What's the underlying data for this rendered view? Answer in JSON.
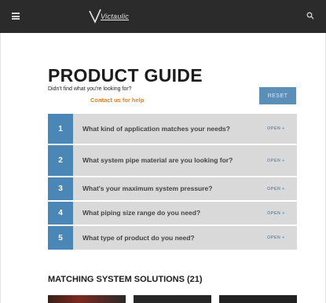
{
  "header": {
    "logo_text": "Victaulic",
    "menu_icon": "hamburger-menu-icon",
    "search_icon": "search-icon"
  },
  "guide": {
    "title": "PRODUCT GUIDE",
    "subtitle": "Didn't find what you're looking for?",
    "contact_link": "Contact us for help",
    "reset_label": "RESET"
  },
  "steps": [
    {
      "num": "1",
      "question": "What kind of application matches your needs?",
      "open": "OPEN +"
    },
    {
      "num": "2",
      "question": "What system pipe material are you looking for?",
      "open": "OPEN +"
    },
    {
      "num": "3",
      "question": "What's your maximum system pressure?",
      "open": "OPEN +"
    },
    {
      "num": "4",
      "question": "What piping size range do you need?",
      "open": "OPEN +"
    },
    {
      "num": "5",
      "question": "What type of product do you need?",
      "open": "OPEN +"
    }
  ],
  "matching": {
    "title": "MATCHING SYSTEM SOLUTIONS (21)"
  },
  "colors": {
    "topbar": "#2b2b2b",
    "accent_blue": "#4a87b6",
    "link_orange": "#f07d1a"
  }
}
